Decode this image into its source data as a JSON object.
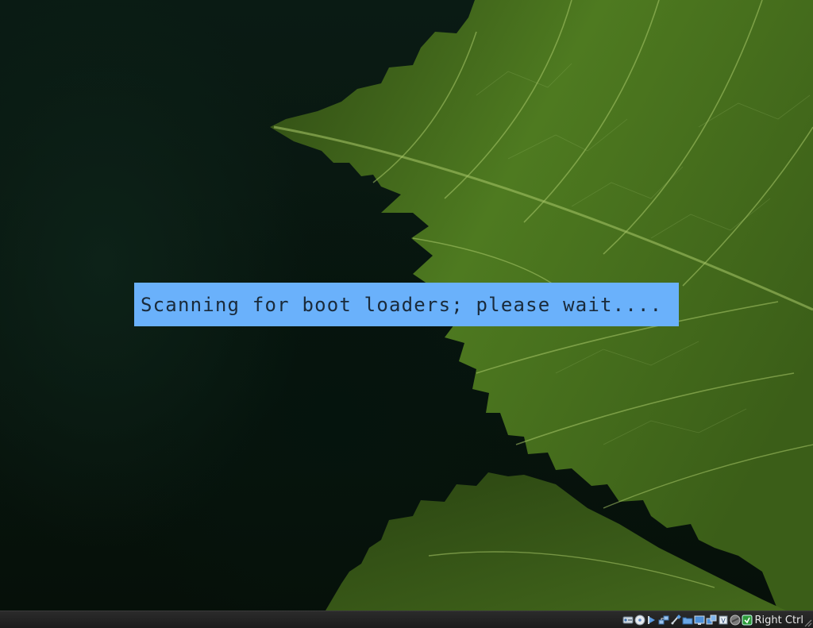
{
  "vm_screen": {
    "boot_message": "Scanning for boot loaders; please wait....",
    "background": "leaf-wallpaper"
  },
  "statusbar": {
    "host_key_label": "Right Ctrl",
    "icons": [
      "hard-disk-icon",
      "optical-drive-icon",
      "audio-icon",
      "network-icon",
      "usb-icon",
      "shared-folders-icon",
      "display-icon",
      "video-capture-icon",
      "cpu-icon",
      "mouse-integration-icon",
      "keyboard-capture-icon"
    ]
  },
  "colors": {
    "banner_bg": "#6ab1fb",
    "banner_text": "#1a2a3a",
    "leaf_green": "#4f7a1e"
  }
}
